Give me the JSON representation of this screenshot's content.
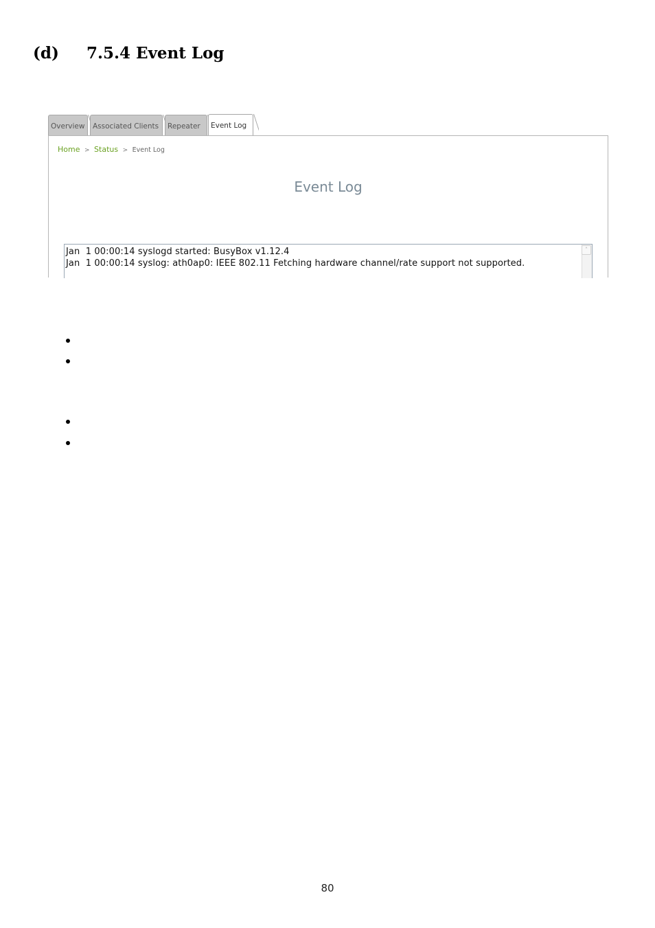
{
  "heading": {
    "number": "(d)",
    "title": "7.5.4 Event Log"
  },
  "tabs": [
    {
      "label": "Overview"
    },
    {
      "label": "Associated Clients"
    },
    {
      "label": "Repeater"
    },
    {
      "label": "Event Log",
      "active": true
    }
  ],
  "breadcrumb": {
    "home": "Home",
    "separator": ">",
    "status": "Status",
    "current": "Event Log"
  },
  "page_title": "Event Log",
  "log_lines": [
    "Jan  1 00:00:14 syslogd started: BusyBox v1.12.4",
    "Jan  1 00:00:14 syslog: ath0ap0: IEEE 802.11 Fetching hardware channel/rate support not supported."
  ],
  "scroll_up_glyph": "˄",
  "bullets": [
    "",
    "",
    "",
    ""
  ],
  "page_number": "80",
  "colors": {
    "link": "#6aa121",
    "title": "#7a8a96",
    "tab_inactive": "#c8c8c8"
  }
}
